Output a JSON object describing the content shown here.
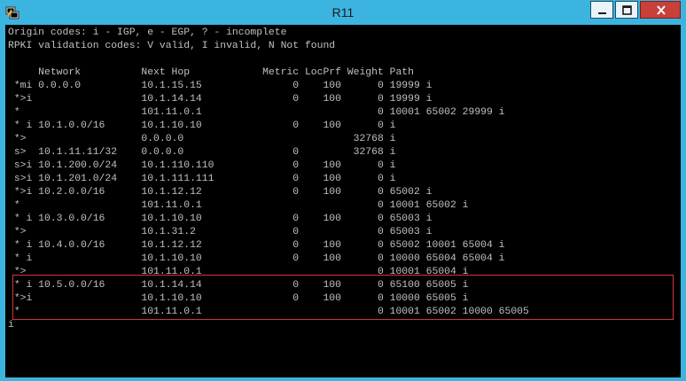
{
  "window": {
    "title": "R11"
  },
  "header": {
    "origin_codes": "Origin codes: i - IGP, e - EGP, ? - incomplete",
    "rpki_codes": "RPKI validation codes: V valid, I invalid, N Not found"
  },
  "table": {
    "header": "     Network          Next Hop            Metric LocPrf Weight Path",
    "rows": [
      " *mi 0.0.0.0          10.1.15.15               0    100      0 19999 i",
      " *>i                  10.1.14.14               0    100      0 19999 i",
      " *                    101.11.0.1                             0 10001 65002 29999 i",
      " * i 10.1.0.0/16      10.1.10.10               0    100      0 i",
      " *>                   0.0.0.0                            32768 i",
      " s>  10.1.11.11/32    0.0.0.0                  0         32768 i",
      " s>i 10.1.200.0/24    10.1.110.110             0    100      0 i",
      " s>i 10.1.201.0/24    10.1.111.111             0    100      0 i",
      " *>i 10.2.0.0/16      10.1.12.12               0    100      0 65002 i",
      " *                    101.11.0.1                             0 10001 65002 i",
      " * i 10.3.0.0/16      10.1.10.10               0    100      0 65003 i",
      " *>                   10.1.31.2                0             0 65003 i",
      " * i 10.4.0.0/16      10.1.12.12               0    100      0 65002 10001 65004 i",
      " * i                  10.1.10.10               0    100      0 10000 65004 65004 i",
      " *>                   101.11.0.1                             0 10001 65004 i",
      " * i 10.5.0.0/16      10.1.14.14               0    100      0 65100 65005 i",
      " *>i                  10.1.10.10               0    100      0 10000 65005 i",
      " *                    101.11.0.1                             0 10001 65002 10000 65005"
    ],
    "partial_last": "i"
  },
  "colors": {
    "titlebar": "#3cb4e0",
    "terminal_bg": "#000000",
    "terminal_fg": "#c0c0c0",
    "highlight_border": "#d9333f",
    "close_button": "#c7403a"
  },
  "icons": {
    "app": "putty-icon",
    "minimize": "minimize-icon",
    "maximize": "maximize-icon",
    "close": "close-icon"
  }
}
